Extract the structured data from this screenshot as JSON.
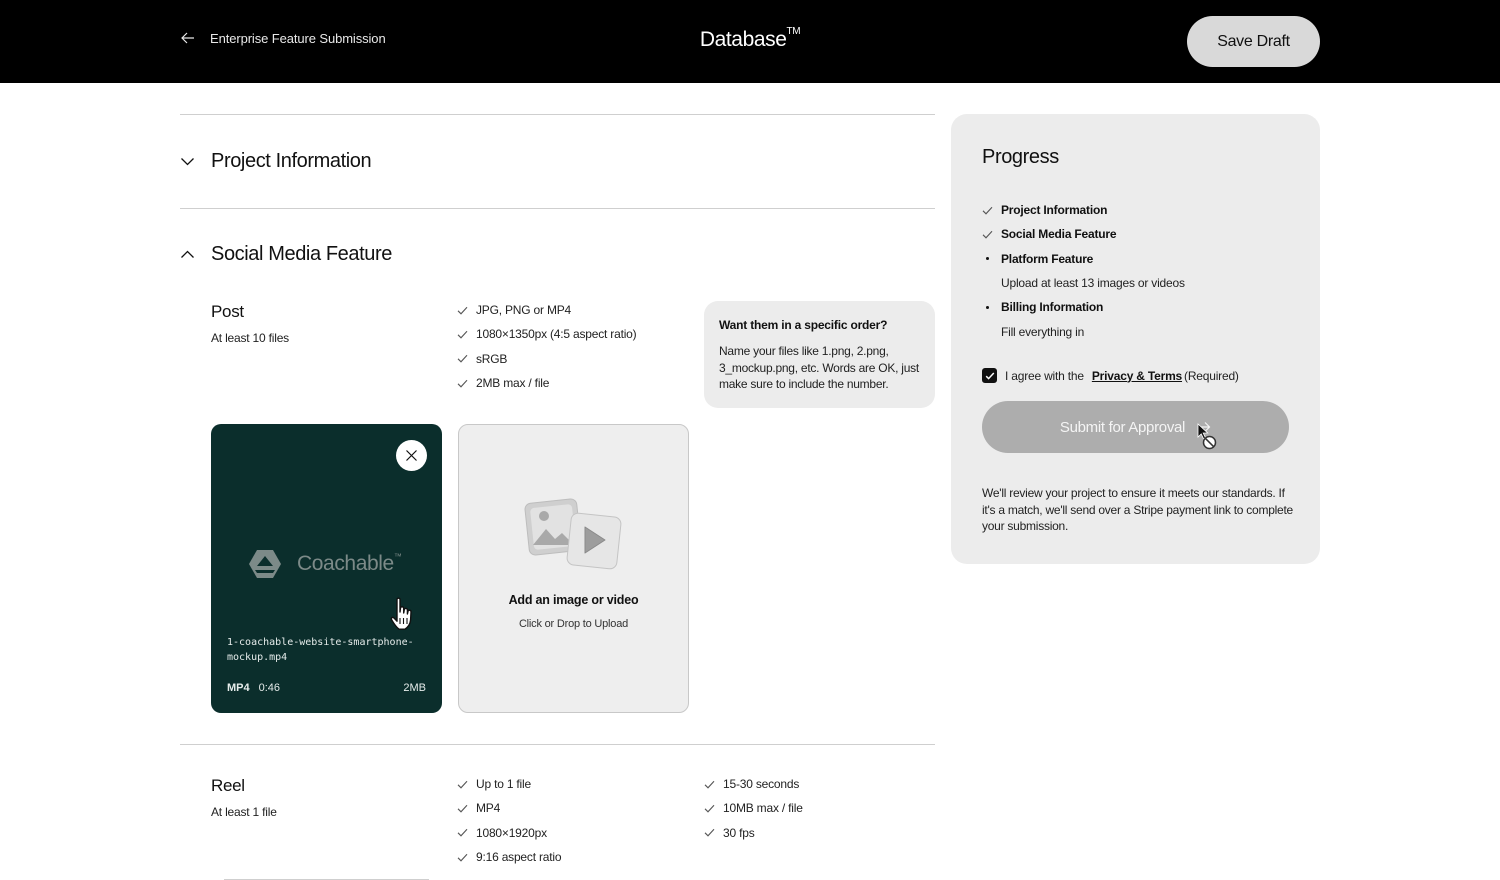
{
  "header": {
    "back_label": "Enterprise Feature Submission",
    "brand": "Database",
    "brand_mark": "TM",
    "save_draft_label": "Save Draft"
  },
  "sections": {
    "project_information": {
      "title": "Project Information",
      "state": "collapsed"
    },
    "social_media_feature": {
      "title": "Social Media Feature",
      "state": "expanded"
    }
  },
  "post": {
    "title": "Post",
    "subtitle": "At least 10 files",
    "requirements": [
      "JPG, PNG or MP4",
      "1080×1350px (4:5 aspect ratio)",
      "sRGB",
      "2MB max / file"
    ],
    "tip": {
      "title": "Want them in a specific order?",
      "body": "Name your files like 1.png, 2.png, 3_mockup.png, etc. Words are OK, just make sure to include the number."
    },
    "uploaded_file": {
      "logo_text": "Coachable",
      "logo_mark": "™",
      "filename": "1-coachable-website-smartphone-mockup.mp4",
      "type": "MP4",
      "duration": "0:46",
      "size": "2MB"
    },
    "dropzone": {
      "title": "Add an image or video",
      "subtitle": "Click or Drop to Upload"
    }
  },
  "reel": {
    "title": "Reel",
    "subtitle": "At least 1 file",
    "requirements_left": [
      "Up to 1 file",
      "MP4",
      "1080×1920px",
      "9:16 aspect ratio"
    ],
    "requirements_right": [
      "15-30 seconds",
      "10MB max / file",
      "30 fps"
    ]
  },
  "progress": {
    "title": "Progress",
    "steps": [
      {
        "label": "Project Information",
        "status": "complete"
      },
      {
        "label": "Social Media Feature",
        "status": "complete"
      },
      {
        "label": "Platform Feature",
        "status": "pending",
        "note": "Upload at least 13 images or videos"
      },
      {
        "label": "Billing Information",
        "status": "pending",
        "note": "Fill everything in"
      }
    ],
    "agreement": {
      "checked": true,
      "prefix": "I agree with the",
      "link": "Privacy & Terms",
      "suffix": "(Required)"
    },
    "submit_label": "Submit for Approval",
    "submit_enabled": false,
    "review_text": "We'll review your project to ensure it meets our standards. If it's a match, we'll send over a Stripe payment link to complete your submission."
  },
  "colors": {
    "header_bg": "#000000",
    "card_bg": "#0b2e2c",
    "panel_bg": "#ececec",
    "button_disabled": "#adadad",
    "save_draft_bg": "#d9d9d9"
  }
}
